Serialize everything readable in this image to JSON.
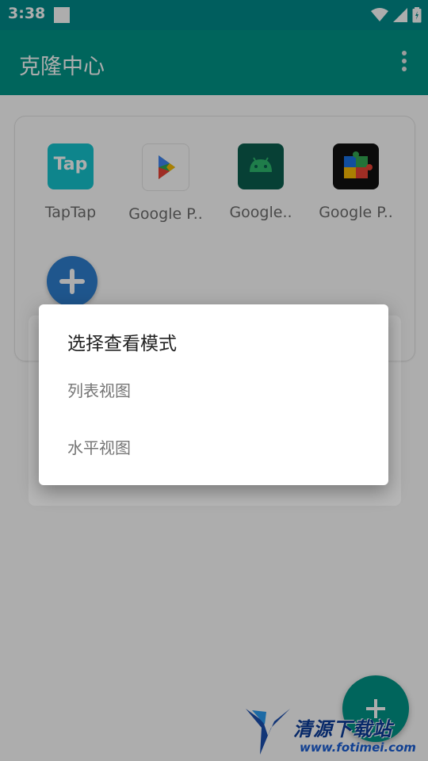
{
  "status_bar": {
    "time": "3:38",
    "icons": [
      "wifi-icon",
      "signal-icon",
      "battery-icon"
    ]
  },
  "app_bar": {
    "title": "克隆中心",
    "menu_icon": "overflow-menu-icon"
  },
  "apps": [
    {
      "label": "TapTap",
      "icon": "taptap-icon",
      "icon_text": "Tap"
    },
    {
      "label": "Google P..",
      "icon": "google-play-icon"
    },
    {
      "label": "Google..",
      "icon": "android-icon"
    },
    {
      "label": "Google P..",
      "icon": "google-play-services-icon"
    }
  ],
  "dialog": {
    "title": "选择查看模式",
    "options": [
      "列表视图",
      "水平视图"
    ]
  },
  "watermark": {
    "name": "清源下载站",
    "url": "www.fotimei.com"
  },
  "colors": {
    "status_bar": "#008b8b",
    "app_bar": "#009688",
    "add_button": "#2f7fd0",
    "fab": "#009688",
    "taptap": "#15c5ce"
  }
}
